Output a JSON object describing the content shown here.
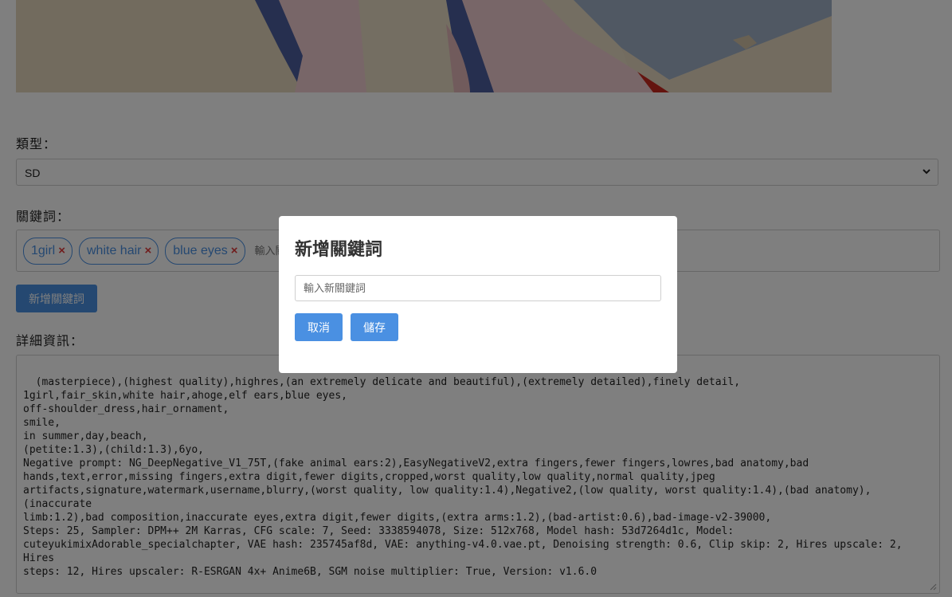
{
  "form": {
    "type_label": "類型：",
    "type_value": "SD",
    "keywords_label": "關鍵詞：",
    "tags": [
      "1girl",
      "white hair",
      "blue eyes"
    ],
    "tag_remove_glyph": "×",
    "tag_input_placeholder": "輸入關鍵詞",
    "add_keyword_button": "新增關鍵詞",
    "details_label": "詳細資訊：",
    "details_text": "(masterpiece),(highest quality),highres,(an extremely delicate and beautiful),(extremely detailed),finely detail,\n1girl,fair_skin,white hair,ahoge,elf ears,blue eyes,\noff-shoulder_dress,hair_ornament,\nsmile,\nin summer,day,beach,\n(petite:1.3),(child:1.3),6yo,\nNegative prompt: NG_DeepNegative_V1_75T,(fake animal ears:2),EasyNegativeV2,extra fingers,fewer fingers,lowres,bad anatomy,bad\nhands,text,error,missing fingers,extra digit,fewer digits,cropped,worst quality,low quality,normal quality,jpeg\nartifacts,signature,watermark,username,blurry,(worst quality, low quality:1.4),Negative2,(low quality, worst quality:1.4),(bad anatomy),(inaccurate\nlimb:1.2),bad composition,inaccurate eyes,extra digit,fewer digits,(extra arms:1.2),(bad-artist:0.6),bad-image-v2-39000,\nSteps: 25, Sampler: DPM++ 2M Karras, CFG scale: 7, Seed: 3338594078, Size: 512x768, Model hash: 53d7264d1c, Model:\ncuteyukimixAdorable_specialchapter, VAE hash: 235745af8d, VAE: anything-v4.0.vae.pt, Denoising strength: 0.6, Clip skip: 2, Hires upscale: 2, Hires\nsteps: 12, Hires upscaler: R-ESRGAN 4x+ Anime6B, SGM noise multiplier: True, Version: v1.6.0"
  },
  "modal": {
    "title": "新增關鍵詞",
    "input_placeholder": "輸入新關鍵詞",
    "input_value": "",
    "cancel_button": "取消",
    "save_button": "儲存"
  },
  "colors": {
    "accent": "#4a90e2",
    "tag_remove": "#e03b3b",
    "overlay": "rgba(0,0,0,0.5)"
  },
  "icons": {
    "select_chevron": "chevron-down-icon",
    "tag_remove": "close-icon",
    "textarea_resize": "resize-grip-icon"
  }
}
